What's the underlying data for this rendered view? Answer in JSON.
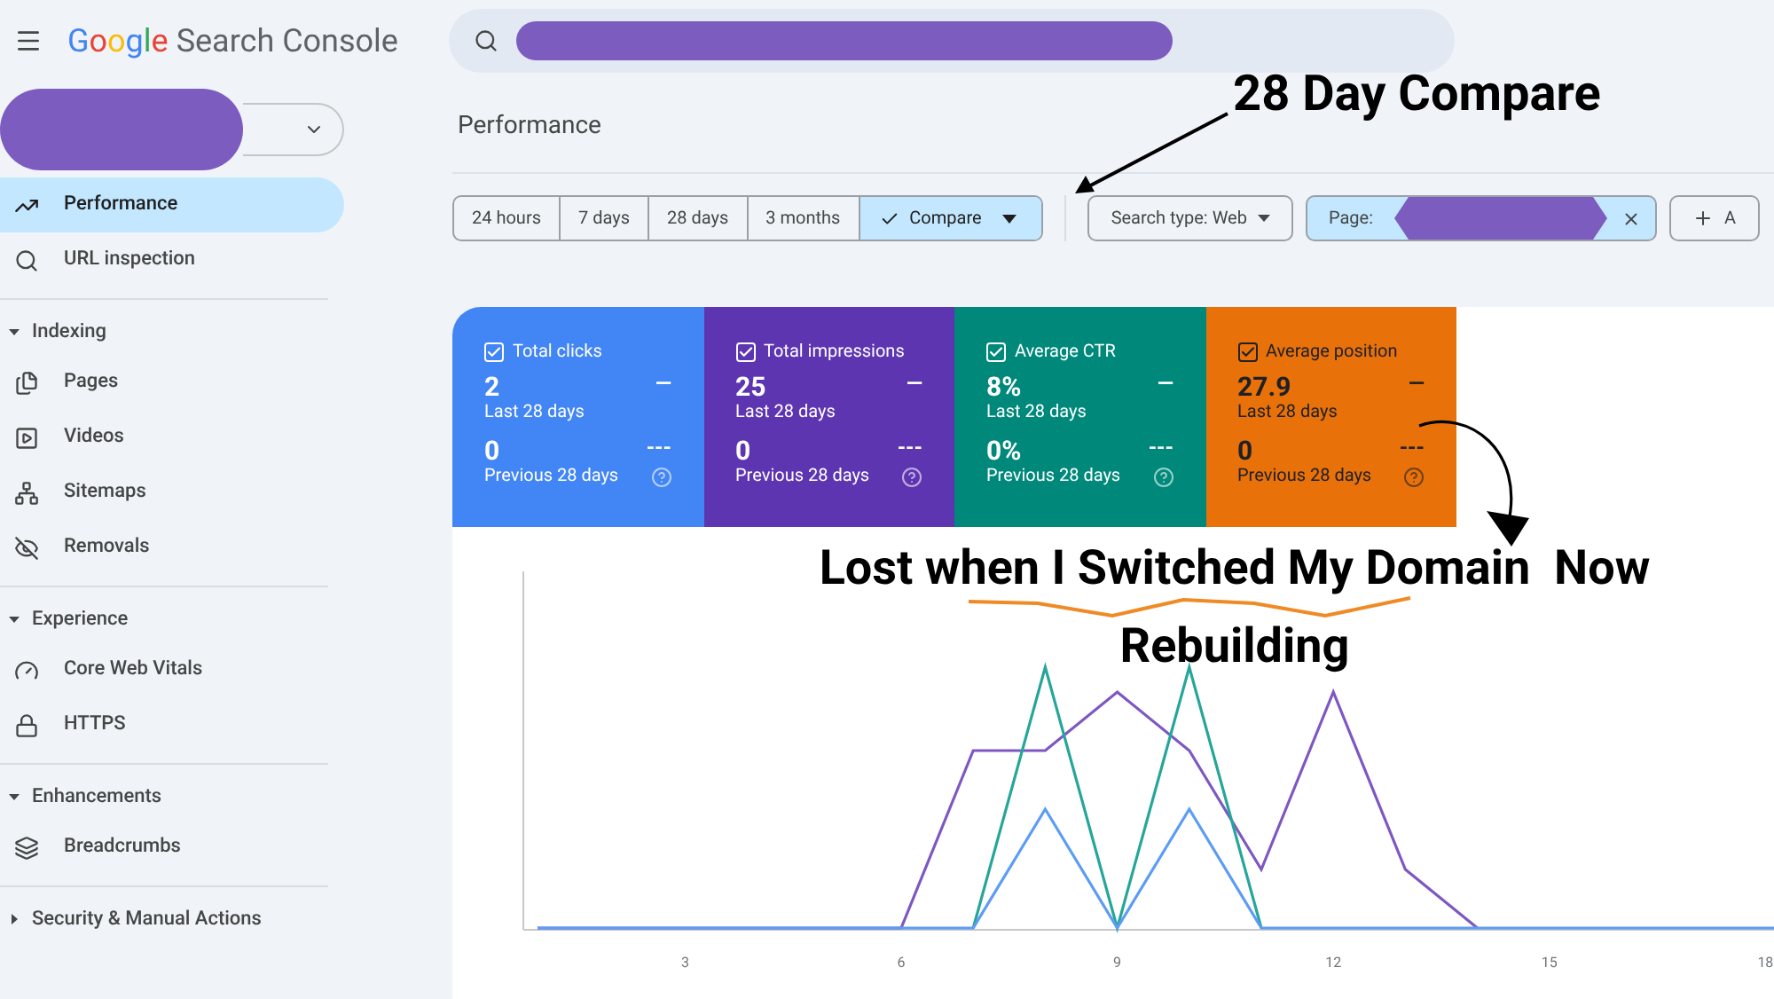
{
  "logo": {
    "brand": "Google",
    "product": "Search Console"
  },
  "sidebar": {
    "items": [
      {
        "label": "Performance",
        "selected": true
      },
      {
        "label": "URL inspection",
        "selected": false
      }
    ],
    "sections": [
      {
        "label": "Indexing",
        "expanded": true,
        "children": [
          {
            "label": "Pages",
            "selected": false
          },
          {
            "label": "Videos",
            "selected": false
          },
          {
            "label": "Sitemaps",
            "selected": false
          },
          {
            "label": "Removals",
            "selected": false
          }
        ]
      },
      {
        "label": "Experience",
        "expanded": true,
        "children": [
          {
            "label": "Core Web Vitals",
            "selected": false
          },
          {
            "label": "HTTPS",
            "selected": false
          }
        ]
      },
      {
        "label": "Enhancements",
        "expanded": true,
        "children": [
          {
            "label": "Breadcrumbs",
            "selected": false
          }
        ]
      },
      {
        "label": "Security & Manual Actions",
        "expanded": false
      }
    ]
  },
  "page_title": "Performance",
  "time_ranges": [
    {
      "label": "24 hours",
      "selected": false
    },
    {
      "label": "7 days",
      "selected": false
    },
    {
      "label": "28 days",
      "selected": false
    },
    {
      "label": "3 months",
      "selected": false
    },
    {
      "label": "Compare",
      "selected": true
    }
  ],
  "filters": [
    {
      "kind": "dropdown",
      "label": "Search type: Web",
      "selected": false
    },
    {
      "kind": "removable",
      "label": "Page: ",
      "selected": true
    },
    {
      "kind": "add",
      "label": "A",
      "selected": false
    }
  ],
  "metrics": [
    {
      "title": "Total clicks",
      "value": "2",
      "period": "Last 28 days",
      "previous_value": "0",
      "previous_period": "Previous 28 days",
      "checked": true,
      "color": "#4285f4"
    },
    {
      "title": "Total impressions",
      "value": "25",
      "period": "Last 28 days",
      "previous_value": "0",
      "previous_period": "Previous 28 days",
      "checked": true,
      "color": "#5e35b1"
    },
    {
      "title": "Average CTR",
      "value": "8%",
      "period": "Last 28 days",
      "previous_value": "0%",
      "previous_period": "Previous 28 days",
      "checked": true,
      "color": "#00897b"
    },
    {
      "title": "Average position",
      "value": "27.9",
      "period": "Last 28 days",
      "previous_value": "0",
      "previous_period": "Previous 28 days",
      "checked": true,
      "color": "#e8710a"
    }
  ],
  "metric_marks": {
    "current": "—",
    "previous": "---"
  },
  "chart": {
    "x_labels": [
      "3",
      "6",
      "9",
      "12",
      "15",
      "18"
    ]
  },
  "annotations": {
    "callout": "28 Day Compare",
    "caption_lines": [
      "Lost when I Switched My Domain  Now",
      "Rebuilding"
    ]
  }
}
